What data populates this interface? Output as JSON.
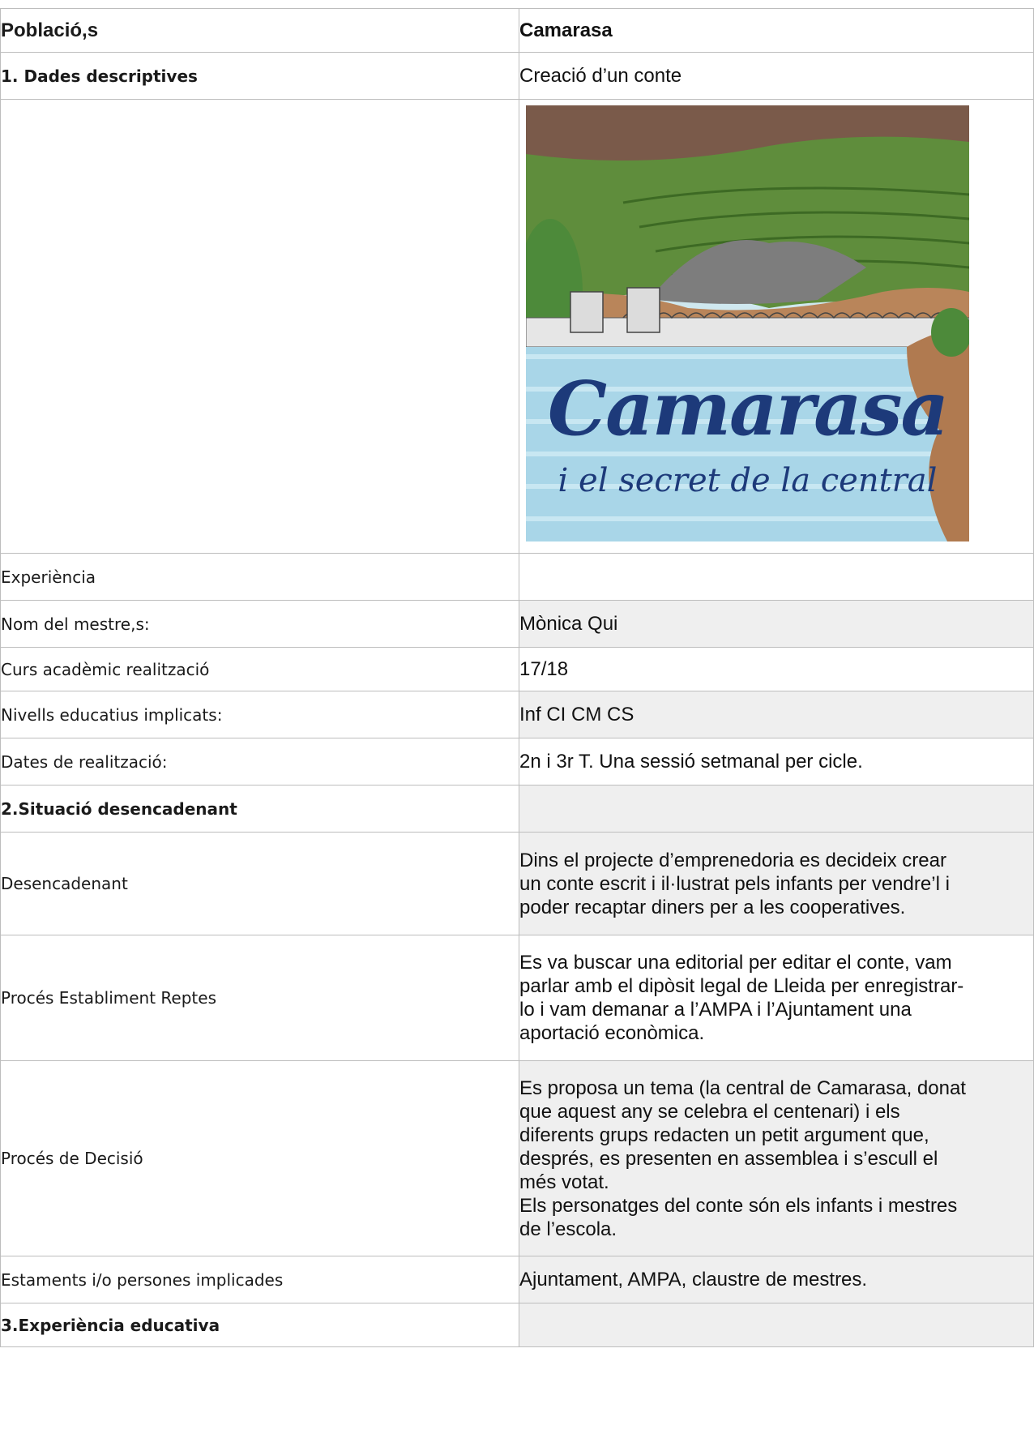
{
  "rows": {
    "header": {
      "label": "Població,s",
      "value": "Camarasa"
    },
    "descriptive": {
      "label": "1. Dades descriptives",
      "value": "Creació d’un conte"
    },
    "cover": {
      "title": "Camarasa",
      "subtitle": "i el secret de la central"
    },
    "experience": {
      "label": "Experiència",
      "value": ""
    },
    "teacher": {
      "label": "Nom del mestre,s:",
      "value": "Mònica Qui"
    },
    "year": {
      "label": "Curs acadèmic realització",
      "value": "17/18"
    },
    "levels": {
      "label": "Nivells educatius implicats:",
      "value": "Inf CI CM CS"
    },
    "dates": {
      "label": "Dates de realització:",
      "value": "2n i 3r T. Una sessió setmanal per cicle."
    },
    "situation": {
      "label": "2.Situació desencadenant",
      "value": ""
    },
    "trigger": {
      "label": "Desencadenant",
      "value": "Dins el projecte d’emprenedoria es decideix crear\nun conte escrit i il·lustrat pels infants per vendre’l i\npoder recaptar diners per a les cooperatives."
    },
    "challenges": {
      "label": "Procés Establiment Reptes",
      "value": "Es va buscar una editorial per editar el conte, vam\nparlar amb el dipòsit legal de Lleida per enregistrar-\nlo  i vam demanar a l’AMPA i l’Ajuntament una\naportació econòmica."
    },
    "decision": {
      "label": "Procés de Decisió",
      "value": "Es proposa un tema (la central de Camarasa, donat\nque aquest any se celebra el centenari) i els\ndiferents grups redacten un petit argument que,\ndesprés, es presenten en assemblea i s’escull el\nmés votat.\nEls personatges del conte són els infants i mestres\nde l’escola."
    },
    "stakeholders": {
      "label": "Estaments i/o persones implicades",
      "value": "Ajuntament, AMPA, claustre de mestres."
    },
    "educational": {
      "label": "3.Experiència educativa",
      "value": ""
    }
  }
}
